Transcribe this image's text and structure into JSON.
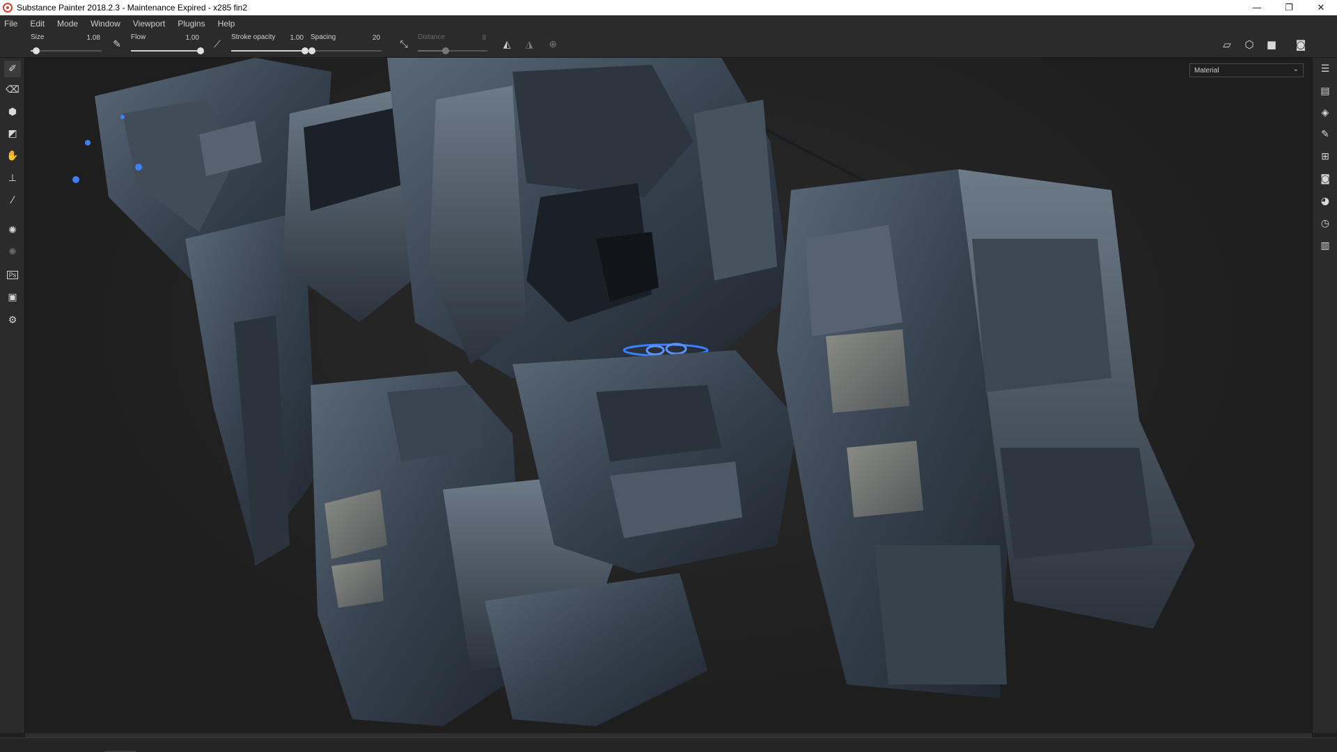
{
  "window": {
    "title": "Substance Painter 2018.2.3 - Maintenance Expired - x285 fin2",
    "controls": [
      "—",
      "❐",
      "✕"
    ]
  },
  "menu": [
    "File",
    "Edit",
    "Mode",
    "Window",
    "Viewport",
    "Plugins",
    "Help"
  ],
  "tool_properties": {
    "size": {
      "label": "Size",
      "value": "1.08",
      "level": 0.08
    },
    "flow": {
      "label": "Flow",
      "value": "1.00",
      "level": 1.0
    },
    "stroke_opacity": {
      "label": "Stroke opacity",
      "value": "1.00",
      "level": 1.0
    },
    "spacing": {
      "label": "Spacing",
      "value": "20",
      "level": 0.02
    },
    "distance": {
      "label": "Distance",
      "value": "8",
      "level": 0.4,
      "disabled": true
    }
  },
  "viewport": {
    "display_mode": "Material"
  },
  "colors": {
    "accent_glow": "#3d7fff",
    "panel_bg": "#2b2b2b",
    "viewport_bg": "#1e1e1e"
  },
  "icons": {
    "left_tools": [
      "paint-brush-icon",
      "eraser-icon",
      "projection-icon",
      "polygon-fill-icon",
      "smudge-icon",
      "clone-icon",
      "color-picker-icon",
      "bake-icon",
      "iray-icon",
      "photoshop-export-icon",
      "export-icon",
      "settings-icon"
    ],
    "right_panels": [
      "layers-panel-icon",
      "texture-set-icon",
      "layer-stack-icon",
      "properties-icon",
      "shelf-icon",
      "display-settings-icon",
      "shader-settings-icon",
      "history-icon",
      "log-icon"
    ]
  }
}
